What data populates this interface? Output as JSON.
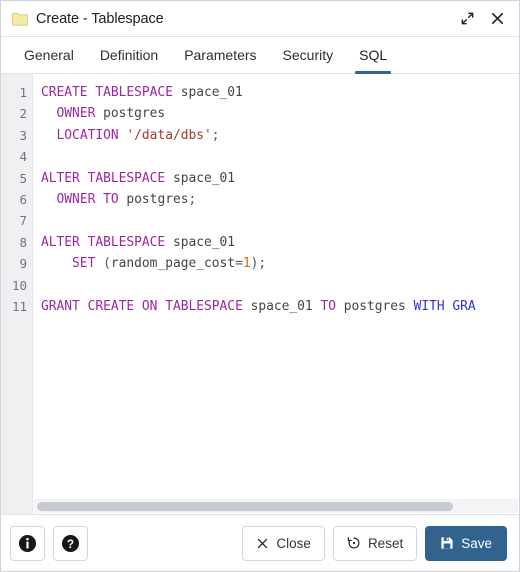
{
  "window": {
    "title": "Create - Tablespace",
    "icon": "folder-icon",
    "expand_icon": "expand-icon",
    "close_icon": "close-icon"
  },
  "tabs": [
    {
      "label": "General",
      "active": false
    },
    {
      "label": "Definition",
      "active": false
    },
    {
      "label": "Parameters",
      "active": false
    },
    {
      "label": "Security",
      "active": false
    },
    {
      "label": "SQL",
      "active": true
    }
  ],
  "editor": {
    "line_numbers": [
      "1",
      "2",
      "3",
      "4",
      "5",
      "6",
      "7",
      "8",
      "9",
      "10",
      "11"
    ],
    "lines": [
      "CREATE TABLESPACE space_01",
      "  OWNER postgres",
      "  LOCATION '/data/dbs';",
      "",
      "ALTER TABLESPACE space_01",
      "  OWNER TO postgres;",
      "",
      "ALTER TABLESPACE space_01",
      "    SET (random_page_cost=1);",
      "",
      "GRANT CREATE ON TABLESPACE space_01 TO postgres WITH GRA"
    ],
    "scrollbar": "horizontal-scrollbar"
  },
  "footer": {
    "info_label": "info-icon",
    "help_label": "help-icon",
    "close_label": "Close",
    "reset_label": "Reset",
    "save_label": "Save"
  },
  "colors": {
    "accent": "#32638f",
    "keyword": "#9c27a0",
    "keyword_alt": "#3434cc",
    "string": "#a63a2a",
    "number": "#c96a17",
    "gutter_bg": "#f0f0f3"
  }
}
